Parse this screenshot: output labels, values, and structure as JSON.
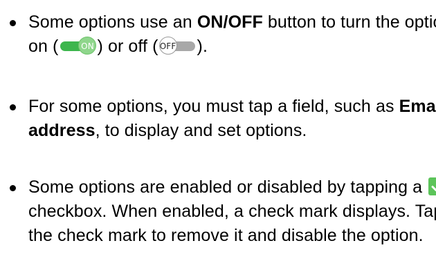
{
  "items": [
    {
      "t1": "Some options use an ",
      "b1": "ON/OFF",
      "t2": " button to turn the option on (",
      "icon_on": {
        "label": "ON",
        "name": "toggle-on-icon"
      },
      "t3": ") or off (",
      "icon_off": {
        "label": "OFF",
        "name": "toggle-off-icon"
      },
      "t4": ")."
    },
    {
      "t1": "For some options, you must tap a field, such as ",
      "b1": "Email address",
      "t2": ", to display and set options."
    },
    {
      "t1": "Some options are enabled or disabled by tapping a ",
      "icon": "checkbox-checked-icon",
      "t2": " checkbox. When enabled, a check mark displays. Tap the check mark to remove it and disable the option."
    }
  ],
  "colors": {
    "toggle_on_track": "#3db64d",
    "toggle_on_knob": "#8fd68c",
    "toggle_off_track": "#a8a8a8",
    "checkbox": "#5cc45a"
  }
}
